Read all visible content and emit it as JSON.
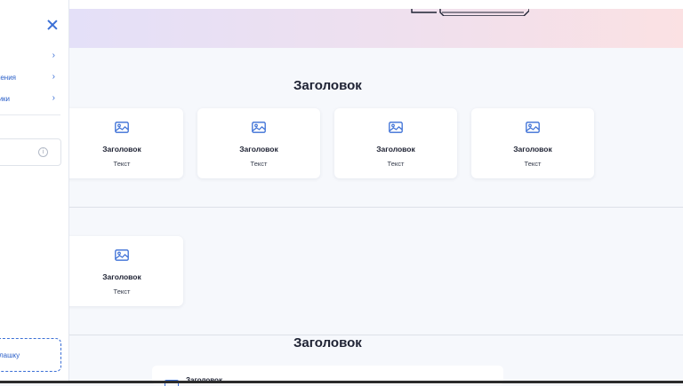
{
  "sidebar": {
    "items": [
      {
        "label": "",
        "chevron": "chevron-right-icon"
      },
      {
        "label": "жения",
        "chevron": "chevron-right-icon"
      },
      {
        "label": "ики",
        "chevron": "chevron-right-icon"
      }
    ],
    "info_icon": "i",
    "dashed_button_label": "лашку"
  },
  "sections": [
    {
      "title": "Заголовок",
      "cards": [
        {
          "title": "Заголовок",
          "text": "Текст"
        },
        {
          "title": "Заголовок",
          "text": "Текст"
        },
        {
          "title": "Заголовок",
          "text": "Текст"
        },
        {
          "title": "Заголовок",
          "text": "Текст"
        }
      ]
    },
    {
      "title": "",
      "cards": [
        {
          "title": "Заголовок",
          "text": "Текст"
        }
      ]
    },
    {
      "title": "Заголовок",
      "cards": [
        {
          "title": "Заголовок",
          "text": ""
        }
      ]
    }
  ],
  "colors": {
    "accent": "#3b6fd6",
    "background": "#f6f8fc"
  }
}
